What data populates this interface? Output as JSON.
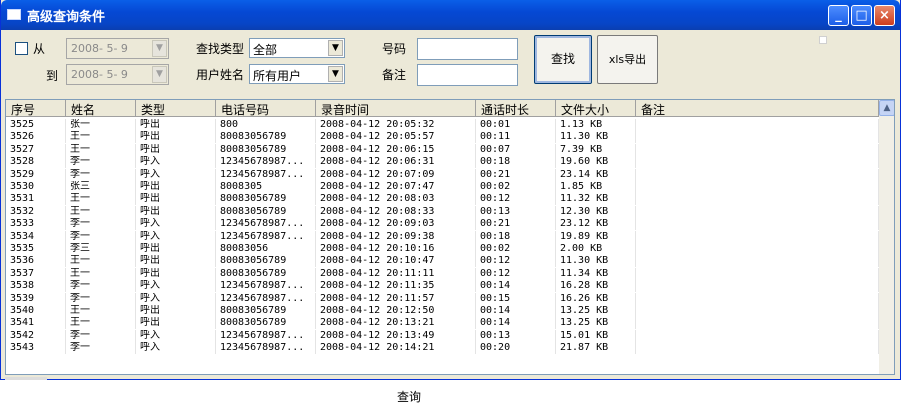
{
  "window": {
    "title": "高级查询条件"
  },
  "filters": {
    "from_label": "从",
    "to_label": "到",
    "from_date": "2008- 5- 9",
    "to_date": "2008- 5- 9",
    "search_type_label": "查找类型",
    "search_type_value": "全部",
    "username_label": "用户姓名",
    "username_value": "所有用户",
    "number_label": "号码",
    "note_label": "备注",
    "search_button": "查找",
    "xls_button": "xls导出"
  },
  "grid": {
    "columns": [
      "序号",
      "姓名",
      "类型",
      "电话号码",
      "录音时间",
      "通话时长",
      "文件大小",
      "备注"
    ],
    "rows": [
      [
        "3525",
        "张一",
        "呼出",
        "800",
        "2008-04-12 20:05:32",
        "00:01",
        "1.13 KB"
      ],
      [
        "3526",
        "王一",
        "呼出",
        "80083056789",
        "2008-04-12 20:05:57",
        "00:11",
        "11.30 KB"
      ],
      [
        "3527",
        "王一",
        "呼出",
        "80083056789",
        "2008-04-12 20:06:15",
        "00:07",
        "7.39 KB"
      ],
      [
        "3528",
        "李一",
        "呼入",
        "12345678987...",
        "2008-04-12 20:06:31",
        "00:18",
        "19.60 KB"
      ],
      [
        "3529",
        "李一",
        "呼入",
        "12345678987...",
        "2008-04-12 20:07:09",
        "00:21",
        "23.14 KB"
      ],
      [
        "3530",
        "张三",
        "呼出",
        "8008305",
        "2008-04-12 20:07:47",
        "00:02",
        "1.85 KB"
      ],
      [
        "3531",
        "王一",
        "呼出",
        "80083056789",
        "2008-04-12 20:08:03",
        "00:12",
        "11.32 KB"
      ],
      [
        "3532",
        "王一",
        "呼出",
        "80083056789",
        "2008-04-12 20:08:33",
        "00:13",
        "12.30 KB"
      ],
      [
        "3533",
        "李一",
        "呼入",
        "12345678987...",
        "2008-04-12 20:09:03",
        "00:21",
        "23.12 KB"
      ],
      [
        "3534",
        "李一",
        "呼入",
        "12345678987...",
        "2008-04-12 20:09:38",
        "00:18",
        "19.89 KB"
      ],
      [
        "3535",
        "李三",
        "呼出",
        "80083056",
        "2008-04-12 20:10:16",
        "00:02",
        "2.00 KB"
      ],
      [
        "3536",
        "王一",
        "呼出",
        "80083056789",
        "2008-04-12 20:10:47",
        "00:12",
        "11.30 KB"
      ],
      [
        "3537",
        "王一",
        "呼出",
        "80083056789",
        "2008-04-12 20:11:11",
        "00:12",
        "11.34 KB"
      ],
      [
        "3538",
        "李一",
        "呼入",
        "12345678987...",
        "2008-04-12 20:11:35",
        "00:14",
        "16.28 KB"
      ],
      [
        "3539",
        "李一",
        "呼入",
        "12345678987...",
        "2008-04-12 20:11:57",
        "00:15",
        "16.26 KB"
      ],
      [
        "3540",
        "王一",
        "呼出",
        "80083056789",
        "2008-04-12 20:12:50",
        "00:14",
        "13.25 KB"
      ],
      [
        "3541",
        "王一",
        "呼出",
        "80083056789",
        "2008-04-12 20:13:21",
        "00:14",
        "13.25 KB"
      ],
      [
        "3542",
        "李一",
        "呼入",
        "12345678987...",
        "2008-04-12 20:13:49",
        "00:13",
        "15.01 KB"
      ],
      [
        "3543",
        "李一",
        "呼入",
        "12345678987...",
        "2008-04-12 20:14:21",
        "00:20",
        "21.87 KB"
      ]
    ]
  },
  "caption": "查询",
  "icons": {
    "minimize": "minimize-icon",
    "maximize": "maximize-icon",
    "close": "close-icon",
    "dropdown": "chevron-down-icon",
    "scroll_up": "chevron-up-icon"
  }
}
